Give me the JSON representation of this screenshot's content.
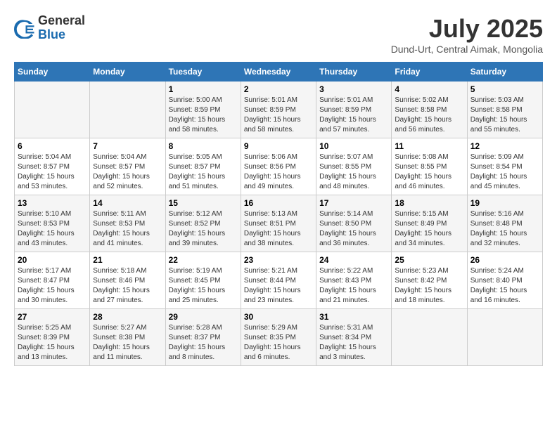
{
  "header": {
    "logo_general": "General",
    "logo_blue": "Blue",
    "month_year": "July 2025",
    "location": "Dund-Urt, Central Aimak, Mongolia"
  },
  "days_of_week": [
    "Sunday",
    "Monday",
    "Tuesday",
    "Wednesday",
    "Thursday",
    "Friday",
    "Saturday"
  ],
  "weeks": [
    [
      {
        "day": "",
        "info": ""
      },
      {
        "day": "",
        "info": ""
      },
      {
        "day": "1",
        "info": "Sunrise: 5:00 AM\nSunset: 8:59 PM\nDaylight: 15 hours\nand 58 minutes."
      },
      {
        "day": "2",
        "info": "Sunrise: 5:01 AM\nSunset: 8:59 PM\nDaylight: 15 hours\nand 58 minutes."
      },
      {
        "day": "3",
        "info": "Sunrise: 5:01 AM\nSunset: 8:59 PM\nDaylight: 15 hours\nand 57 minutes."
      },
      {
        "day": "4",
        "info": "Sunrise: 5:02 AM\nSunset: 8:58 PM\nDaylight: 15 hours\nand 56 minutes."
      },
      {
        "day": "5",
        "info": "Sunrise: 5:03 AM\nSunset: 8:58 PM\nDaylight: 15 hours\nand 55 minutes."
      }
    ],
    [
      {
        "day": "6",
        "info": "Sunrise: 5:04 AM\nSunset: 8:57 PM\nDaylight: 15 hours\nand 53 minutes."
      },
      {
        "day": "7",
        "info": "Sunrise: 5:04 AM\nSunset: 8:57 PM\nDaylight: 15 hours\nand 52 minutes."
      },
      {
        "day": "8",
        "info": "Sunrise: 5:05 AM\nSunset: 8:57 PM\nDaylight: 15 hours\nand 51 minutes."
      },
      {
        "day": "9",
        "info": "Sunrise: 5:06 AM\nSunset: 8:56 PM\nDaylight: 15 hours\nand 49 minutes."
      },
      {
        "day": "10",
        "info": "Sunrise: 5:07 AM\nSunset: 8:55 PM\nDaylight: 15 hours\nand 48 minutes."
      },
      {
        "day": "11",
        "info": "Sunrise: 5:08 AM\nSunset: 8:55 PM\nDaylight: 15 hours\nand 46 minutes."
      },
      {
        "day": "12",
        "info": "Sunrise: 5:09 AM\nSunset: 8:54 PM\nDaylight: 15 hours\nand 45 minutes."
      }
    ],
    [
      {
        "day": "13",
        "info": "Sunrise: 5:10 AM\nSunset: 8:53 PM\nDaylight: 15 hours\nand 43 minutes."
      },
      {
        "day": "14",
        "info": "Sunrise: 5:11 AM\nSunset: 8:53 PM\nDaylight: 15 hours\nand 41 minutes."
      },
      {
        "day": "15",
        "info": "Sunrise: 5:12 AM\nSunset: 8:52 PM\nDaylight: 15 hours\nand 39 minutes."
      },
      {
        "day": "16",
        "info": "Sunrise: 5:13 AM\nSunset: 8:51 PM\nDaylight: 15 hours\nand 38 minutes."
      },
      {
        "day": "17",
        "info": "Sunrise: 5:14 AM\nSunset: 8:50 PM\nDaylight: 15 hours\nand 36 minutes."
      },
      {
        "day": "18",
        "info": "Sunrise: 5:15 AM\nSunset: 8:49 PM\nDaylight: 15 hours\nand 34 minutes."
      },
      {
        "day": "19",
        "info": "Sunrise: 5:16 AM\nSunset: 8:48 PM\nDaylight: 15 hours\nand 32 minutes."
      }
    ],
    [
      {
        "day": "20",
        "info": "Sunrise: 5:17 AM\nSunset: 8:47 PM\nDaylight: 15 hours\nand 30 minutes."
      },
      {
        "day": "21",
        "info": "Sunrise: 5:18 AM\nSunset: 8:46 PM\nDaylight: 15 hours\nand 27 minutes."
      },
      {
        "day": "22",
        "info": "Sunrise: 5:19 AM\nSunset: 8:45 PM\nDaylight: 15 hours\nand 25 minutes."
      },
      {
        "day": "23",
        "info": "Sunrise: 5:21 AM\nSunset: 8:44 PM\nDaylight: 15 hours\nand 23 minutes."
      },
      {
        "day": "24",
        "info": "Sunrise: 5:22 AM\nSunset: 8:43 PM\nDaylight: 15 hours\nand 21 minutes."
      },
      {
        "day": "25",
        "info": "Sunrise: 5:23 AM\nSunset: 8:42 PM\nDaylight: 15 hours\nand 18 minutes."
      },
      {
        "day": "26",
        "info": "Sunrise: 5:24 AM\nSunset: 8:40 PM\nDaylight: 15 hours\nand 16 minutes."
      }
    ],
    [
      {
        "day": "27",
        "info": "Sunrise: 5:25 AM\nSunset: 8:39 PM\nDaylight: 15 hours\nand 13 minutes."
      },
      {
        "day": "28",
        "info": "Sunrise: 5:27 AM\nSunset: 8:38 PM\nDaylight: 15 hours\nand 11 minutes."
      },
      {
        "day": "29",
        "info": "Sunrise: 5:28 AM\nSunset: 8:37 PM\nDaylight: 15 hours\nand 8 minutes."
      },
      {
        "day": "30",
        "info": "Sunrise: 5:29 AM\nSunset: 8:35 PM\nDaylight: 15 hours\nand 6 minutes."
      },
      {
        "day": "31",
        "info": "Sunrise: 5:31 AM\nSunset: 8:34 PM\nDaylight: 15 hours\nand 3 minutes."
      },
      {
        "day": "",
        "info": ""
      },
      {
        "day": "",
        "info": ""
      }
    ]
  ]
}
